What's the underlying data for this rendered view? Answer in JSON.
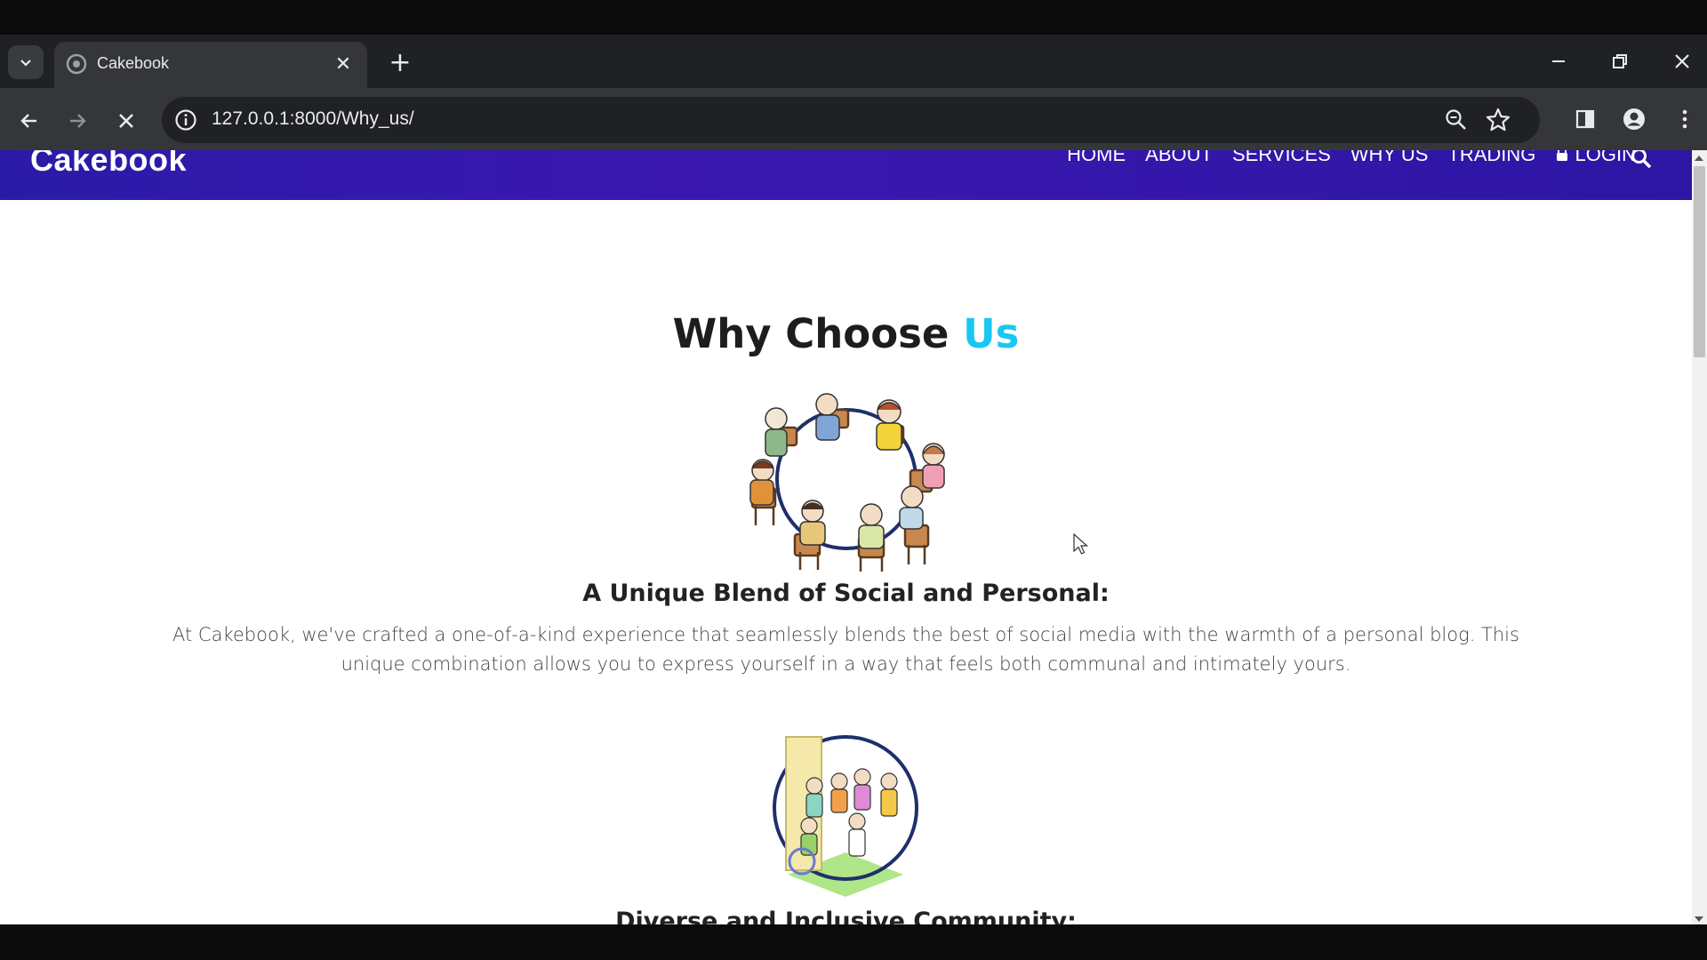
{
  "browser": {
    "tab_title": "Cakebook",
    "url": "127.0.0.1:8000/Why_us/",
    "new_tab_symbol": "+",
    "tab_close_symbol": "✕"
  },
  "site": {
    "brand": "Cakebook",
    "nav": [
      "HOME",
      "ABOUT",
      "SERVICES",
      "WHY US",
      "TRADING",
      "LOGIN"
    ],
    "accent_color": "#18c7f2",
    "nav_color": "#3a18b0"
  },
  "page": {
    "heading_main": "Why Choose ",
    "heading_accent": "Us",
    "features": [
      {
        "title": "A Unique Blend of Social and Personal:",
        "text": "At Cakebook, we've crafted a one-of-a-kind experience that seamlessly blends the best of social media with the warmth of a personal blog. This unique combination allows you to express yourself in a way that feels both communal and intimately yours."
      },
      {
        "title": "Diverse and Inclusive Community:"
      }
    ]
  },
  "icons": [
    "tab-search-icon",
    "favicon-icon",
    "close-icon",
    "plus-icon",
    "minimize-icon",
    "restore-icon",
    "window-close-icon",
    "back-arrow-icon",
    "forward-arrow-icon",
    "stop-loading-icon",
    "site-info-icon",
    "zoom-icon",
    "bookmark-star-icon",
    "side-panel-icon",
    "profile-icon",
    "kebab-menu-icon",
    "lock-icon",
    "search-icon"
  ]
}
